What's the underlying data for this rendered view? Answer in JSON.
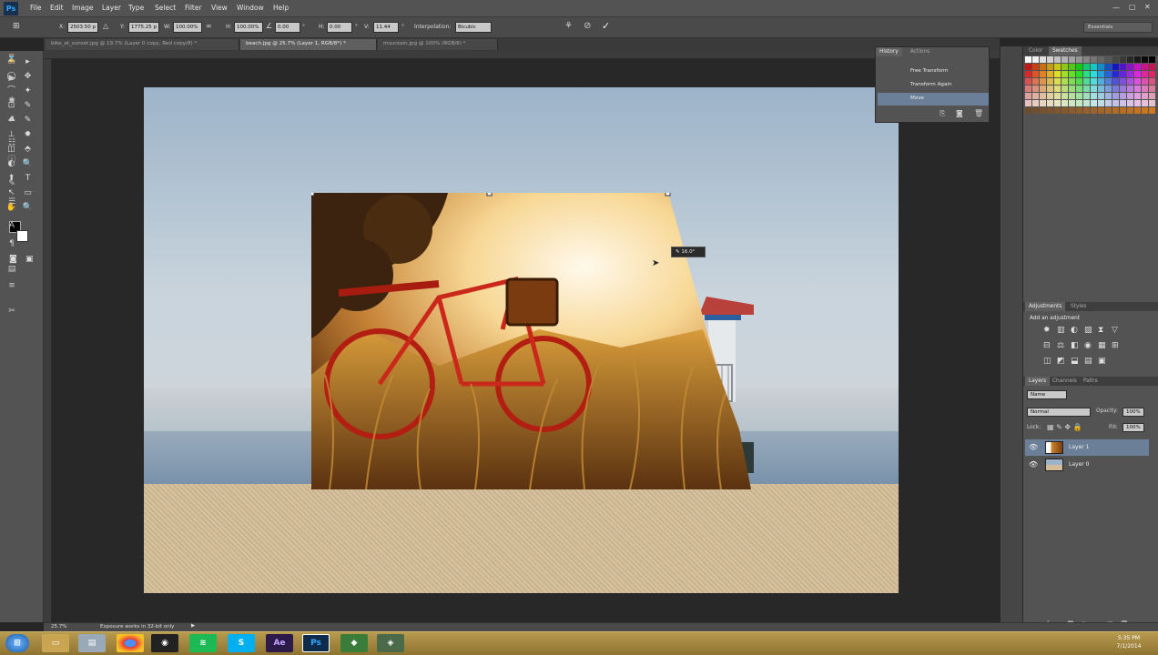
{
  "app": {
    "logo": "Ps",
    "menus": [
      "File",
      "Edit",
      "Image",
      "Layer",
      "Type",
      "Select",
      "Filter",
      "View",
      "Window",
      "Help"
    ]
  },
  "options": {
    "x_label": "X:",
    "x_value": "2503.50 p",
    "y_label": "Y:",
    "y_value": "1775.25 p",
    "w_label": "W:",
    "w_value": "100.00%",
    "h_label": "H:",
    "h_value": "100.00%",
    "angle_value": "0.00",
    "hskew_label": "H:",
    "hskew_value": "0.00",
    "vskew_label": "V:",
    "vskew_value": "11.44",
    "interp_label": "Interpolation:",
    "interp_value": "Bicubic",
    "workspace": "Essentials"
  },
  "tabs": [
    {
      "label": "bike_at_sunset.jpg @ 19.7% (Layer 0 copy, Red copy/8) *",
      "active": false
    },
    {
      "label": "beach.jpg @ 25.7% (Layer 1, RGB/8*) *",
      "active": true
    },
    {
      "label": "mountain.jpg @ 100% (RGB/8) *",
      "active": false
    }
  ],
  "tools": [
    "▭",
    "▸",
    "◯",
    "✥",
    "⌒",
    "✦",
    "⊡",
    "✎",
    "✐",
    "✎",
    "⊥",
    "✹",
    "◫",
    "⬘",
    "◐",
    "🔍",
    "⬆",
    "T",
    "↖",
    "▭",
    "✋",
    "🔍"
  ],
  "canvas": {
    "skew_readout": "16.0°"
  },
  "history": {
    "tabs": [
      "History",
      "Actions"
    ],
    "items": [
      {
        "label": "Free Transform",
        "selected": false
      },
      {
        "label": "Transform Again",
        "selected": false
      },
      {
        "label": "Move",
        "selected": true
      }
    ]
  },
  "swatch_panel": {
    "tabs": [
      "Color",
      "Swatches"
    ]
  },
  "adjustments": {
    "tabs": [
      "Adjustments",
      "Styles"
    ],
    "caption": "Add an adjustment"
  },
  "layers": {
    "tabs": [
      "Layers",
      "Channels",
      "Paths"
    ],
    "filter": "Name",
    "blend": "Normal",
    "opacity_label": "Opacity:",
    "opacity": "100%",
    "lock_label": "Lock:",
    "fill_label": "Fill:",
    "fill": "100%",
    "items": [
      {
        "name": "Layer 1",
        "selected": true
      },
      {
        "name": "Layer 0",
        "selected": false
      }
    ]
  },
  "status": {
    "zoom": "25.7%",
    "message": "Exposure works in 32-bit only"
  },
  "taskbar": {
    "apps": [
      "Ae",
      "Ps"
    ],
    "time": "5:35 PM",
    "date": "7/1/2014"
  }
}
